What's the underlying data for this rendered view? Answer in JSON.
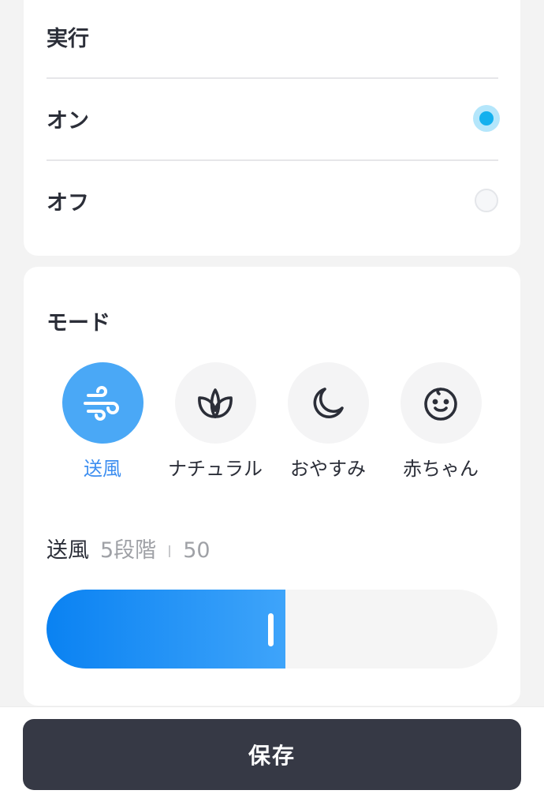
{
  "execution": {
    "title": "実行",
    "options": [
      {
        "label": "オン",
        "selected": true
      },
      {
        "label": "オフ",
        "selected": false
      }
    ]
  },
  "mode": {
    "title": "モード",
    "items": [
      {
        "label": "送風",
        "icon": "wind-icon",
        "active": true
      },
      {
        "label": "ナチュラル",
        "icon": "leaf-icon",
        "active": false
      },
      {
        "label": "おやすみ",
        "icon": "moon-icon",
        "active": false
      },
      {
        "label": "赤ちゃん",
        "icon": "baby-face-icon",
        "active": false
      }
    ]
  },
  "level": {
    "mode_name": "送風",
    "steps": "5段階",
    "value": "50",
    "fill_percent": 53
  },
  "footer": {
    "save_label": "保存"
  },
  "colors": {
    "accent": "#4aa8f6",
    "radio_active": "#13b0ee",
    "save_button": "#363945"
  }
}
